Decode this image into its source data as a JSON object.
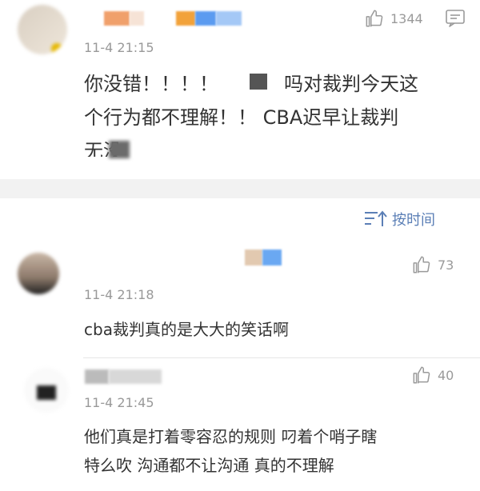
{
  "top_comment": {
    "time": "11-4 21:15",
    "likes": "1344",
    "text_lines": [
      "你没错！！！！",
      "吗对裁判今天这",
      "个行为都不理解！！ CBA迟早让裁判",
      "无没"
    ]
  },
  "sort": {
    "label": "按时间"
  },
  "replies": [
    {
      "time": "11-4 21:18",
      "likes": "73",
      "text": "cba裁判真的是大大的笑话啊"
    },
    {
      "time": "11-4 21:45",
      "likes": "40",
      "text_lines": [
        "他们真是打着零容忍的规则  叼着个哨子瞎",
        "特么吹  沟通都不让沟通  真的不理解"
      ]
    }
  ],
  "colors": {
    "accent": "#5b7fb6",
    "muted": "#999999",
    "divider": "#e6e6e6"
  },
  "icons": [
    "thumbs-up-icon",
    "comment-icon",
    "sort-icon"
  ]
}
